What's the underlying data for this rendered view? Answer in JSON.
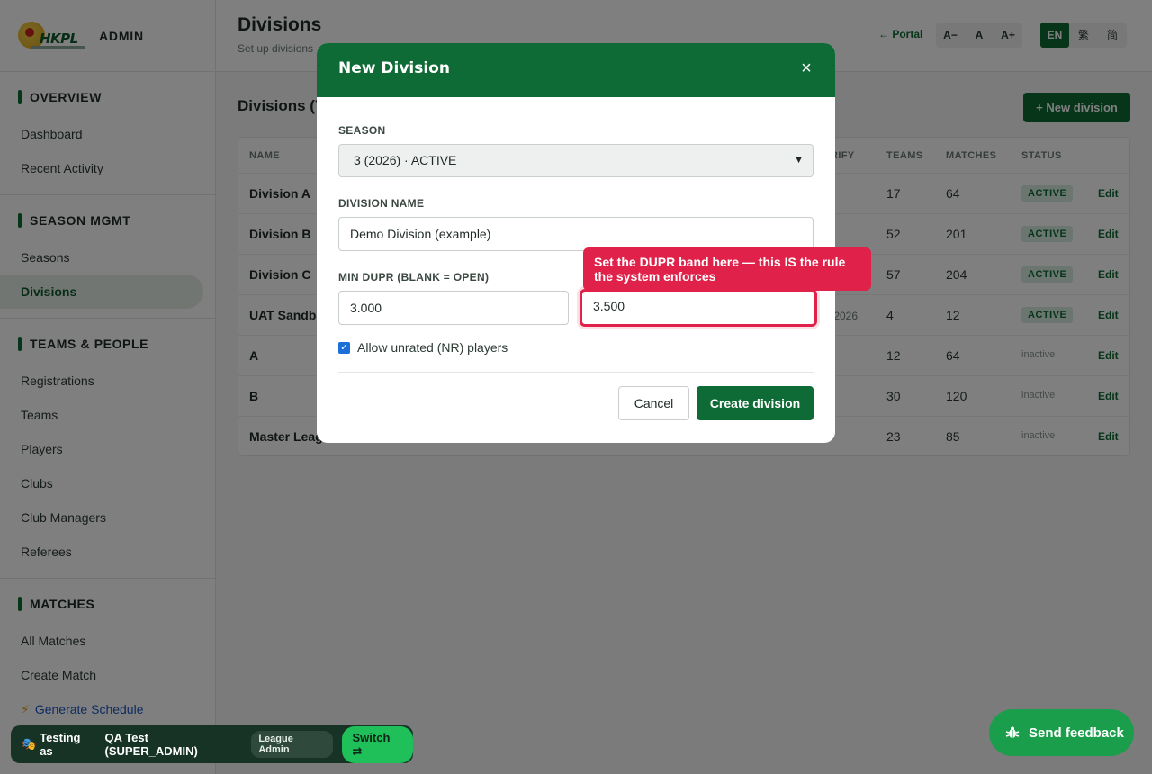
{
  "brand": {
    "logo_text": "HKPL",
    "admin_label": "ADMIN"
  },
  "sidebar": {
    "sections": [
      {
        "title": "OVERVIEW",
        "items": [
          "Dashboard",
          "Recent Activity"
        ]
      },
      {
        "title": "SEASON MGMT",
        "items": [
          "Seasons",
          "Divisions"
        ]
      },
      {
        "title": "TEAMS & PEOPLE",
        "items": [
          "Registrations",
          "Teams",
          "Players",
          "Clubs",
          "Club Managers",
          "Referees"
        ]
      },
      {
        "title": "MATCHES",
        "items": [
          "All Matches",
          "Create Match",
          "Generate Schedule"
        ]
      }
    ],
    "active_item": "Divisions"
  },
  "header": {
    "title": "Divisions",
    "subtitle": "Set up divisions",
    "portal_link": "← Portal",
    "font_sizes": [
      "A−",
      "A",
      "A+"
    ],
    "languages": [
      "EN",
      "繁",
      "简"
    ],
    "active_language": "EN"
  },
  "main": {
    "section_title": "Divisions (7",
    "new_button": "+ New division",
    "columns": [
      "NAME",
      "RIFY",
      "TEAMS",
      "MATCHES",
      "STATUS"
    ],
    "rows": [
      {
        "name": "Division A",
        "frag": "",
        "teams": "17",
        "matches": "64",
        "status": "ACTIVE",
        "edit": "Edit"
      },
      {
        "name": "Division B",
        "frag": "",
        "teams": "52",
        "matches": "201",
        "status": "ACTIVE",
        "edit": "Edit"
      },
      {
        "name": "Division C",
        "frag": "",
        "teams": "57",
        "matches": "204",
        "status": "ACTIVE",
        "edit": "Edit"
      },
      {
        "name": "UAT Sandbo",
        "frag": "/2026",
        "teams": "4",
        "matches": "12",
        "status": "ACTIVE",
        "edit": "Edit"
      },
      {
        "name": "A",
        "frag": "",
        "teams": "12",
        "matches": "64",
        "status": "inactive",
        "edit": "Edit"
      },
      {
        "name": "B",
        "frag": "",
        "teams": "30",
        "matches": "120",
        "status": "inactive",
        "edit": "Edit"
      },
      {
        "name": "Master Leag",
        "frag": "",
        "teams": "23",
        "matches": "85",
        "status": "inactive",
        "edit": "Edit"
      }
    ]
  },
  "modal": {
    "title": "New Division",
    "close_icon": "close-icon",
    "season_label": "SEASON",
    "season_value": "3 (2026) · ACTIVE",
    "name_label": "DIVISION NAME",
    "name_value": "Demo Division (example)",
    "min_label": "MIN DUPR (BLANK = OPEN)",
    "min_value": "3.000",
    "max_value": "3.500",
    "checkbox_label": "Allow unrated (NR) players",
    "checkbox_checked": true,
    "cancel_label": "Cancel",
    "create_label": "Create division"
  },
  "tooltip": {
    "text": "Set the DUPR band here — this IS the rule the system enforces"
  },
  "testing_bar": {
    "label": "Testing as",
    "user": "QA Test (SUPER_ADMIN)",
    "role": "League Admin",
    "switch_label": "Switch ⇄"
  },
  "feedback": {
    "label": "Send feedback"
  },
  "colors": {
    "brand_green": "#0e6b35",
    "highlight_red": "#e0224a",
    "testing_bg": "#173326"
  }
}
